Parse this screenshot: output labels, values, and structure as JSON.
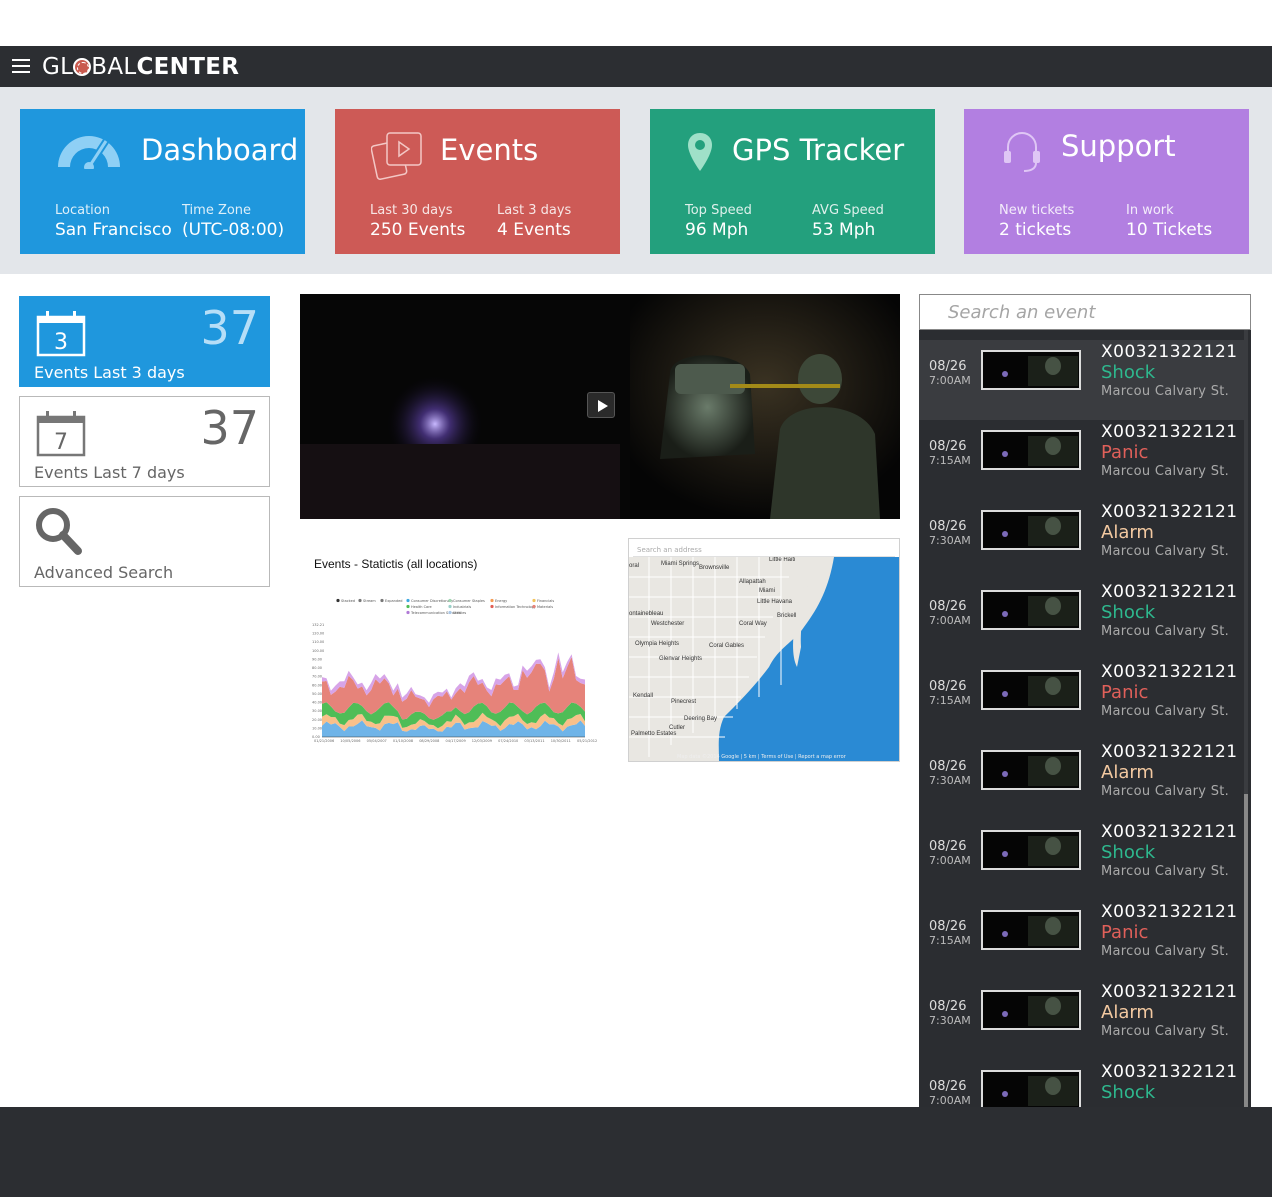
{
  "app": {
    "logo_part1": "GL",
    "logo_part2": "BAL",
    "logo_part3": "CENTER"
  },
  "tiles": [
    {
      "title": "Dashboard",
      "color": "#1f97dd",
      "stats": [
        {
          "label": "Location",
          "value": "San Francisco"
        },
        {
          "label": "Time Zone",
          "value": "(UTC-08:00)"
        }
      ]
    },
    {
      "title": "Events",
      "color": "#cd5a56",
      "stats": [
        {
          "label": "Last 30 days",
          "value": "250 Events"
        },
        {
          "label": "Last 3 days",
          "value": "4 Events"
        }
      ]
    },
    {
      "title": "GPS Tracker",
      "color": "#23a07d",
      "stats": [
        {
          "label": "Top Speed",
          "value": "96 Mph"
        },
        {
          "label": "AVG Speed",
          "value": "53 Mph"
        }
      ]
    },
    {
      "title": "Support",
      "color": "#b27fe1",
      "stats": [
        {
          "label": "New tickets",
          "value": "2 tickets"
        },
        {
          "label": "In work",
          "value": "10 Tickets"
        }
      ]
    }
  ],
  "cards": [
    {
      "day": "3",
      "count": "37",
      "caption": "Events Last 3 days"
    },
    {
      "day": "7",
      "count": "37",
      "caption": "Events Last 7 days"
    },
    {
      "caption": "Advanced Search"
    }
  ],
  "chart": {
    "title": "Events - Statictis (all locations)",
    "legend": [
      "Stacked",
      "Stream",
      "Expanded",
      "Consumer Discretionary",
      "Consumer Staples",
      "Energy",
      "Financials",
      "Health Care",
      "Industrials",
      "Information Technology",
      "Materials",
      "Telecommunication Services",
      "Utilities"
    ],
    "y_ticks": [
      "132.21",
      "120.00",
      "110.00",
      "100.00",
      "90.00",
      "80.00",
      "70.00",
      "60.00",
      "50.00",
      "40.00",
      "30.00",
      "20.00",
      "10.00",
      "0.00"
    ],
    "x_ticks": [
      "01/21/2006",
      "10/05/2006",
      "05/04/2007",
      "01/10/2008",
      "08/29/2008",
      "04/17/2009",
      "12/03/2009",
      "07/24/2010",
      "03/13/2011",
      "10/30/2011",
      "05/21/2012"
    ]
  },
  "map": {
    "search_placeholder": "Search an address",
    "labels": [
      "Miami Springs",
      "Brownsville",
      "Little Haiti",
      "Allapattah",
      "Miami",
      "Little Havana",
      "Westchester",
      "Coral Way",
      "Coral Gables",
      "Olympia Heights",
      "Glenvar Heights",
      "Kendall",
      "Pinecrest",
      "Cutler",
      "Palmetto Estates",
      "Deering Bay",
      "ontainebleau",
      "oral",
      "Brickell"
    ],
    "footer": "Map data ©2014 Google | 5 km | Terms of Use | Report a map error"
  },
  "search": {
    "placeholder": "Search an event"
  },
  "type_colors": {
    "Shock": "#2eb88e",
    "Panic": "#e0605a",
    "Alarm": "#f3c9a1"
  },
  "events": [
    {
      "date": "08/26",
      "time": "7:00AM",
      "id": "X00321322121",
      "type": "Shock",
      "address": "Marcou Calvary St."
    },
    {
      "date": "08/26",
      "time": "7:15AM",
      "id": "X00321322121",
      "type": "Panic",
      "address": "Marcou Calvary St."
    },
    {
      "date": "08/26",
      "time": "7:30AM",
      "id": "X00321322121",
      "type": "Alarm",
      "address": "Marcou Calvary St."
    },
    {
      "date": "08/26",
      "time": "7:00AM",
      "id": "X00321322121",
      "type": "Shock",
      "address": "Marcou Calvary St."
    },
    {
      "date": "08/26",
      "time": "7:15AM",
      "id": "X00321322121",
      "type": "Panic",
      "address": "Marcou Calvary St."
    },
    {
      "date": "08/26",
      "time": "7:30AM",
      "id": "X00321322121",
      "type": "Alarm",
      "address": "Marcou Calvary St."
    },
    {
      "date": "08/26",
      "time": "7:00AM",
      "id": "X00321322121",
      "type": "Shock",
      "address": "Marcou Calvary St."
    },
    {
      "date": "08/26",
      "time": "7:15AM",
      "id": "X00321322121",
      "type": "Panic",
      "address": "Marcou Calvary St."
    },
    {
      "date": "08/26",
      "time": "7:30AM",
      "id": "X00321322121",
      "type": "Alarm",
      "address": "Marcou Calvary St."
    },
    {
      "date": "08/26",
      "time": "7:00AM",
      "id": "X00321322121",
      "type": "Shock",
      "address": ""
    }
  ]
}
